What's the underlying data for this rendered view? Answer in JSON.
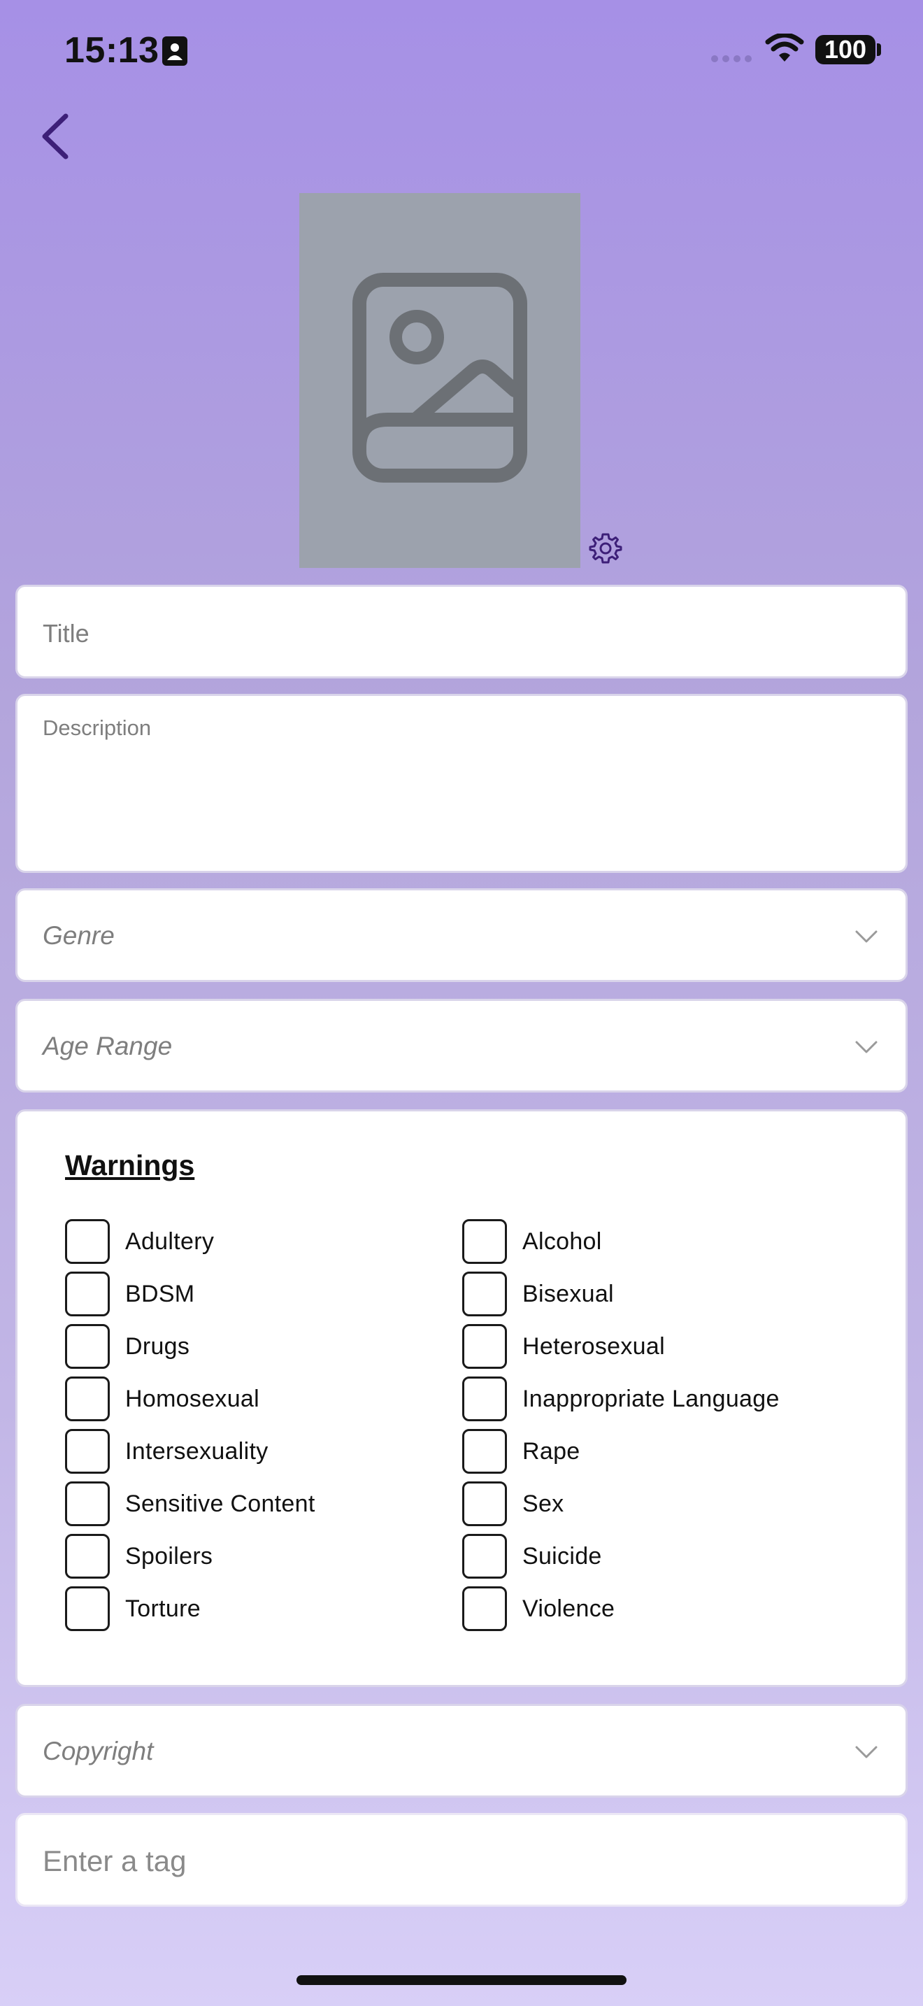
{
  "status_bar": {
    "time": "15:13",
    "battery": "100"
  },
  "form": {
    "title_placeholder": "Title",
    "description_placeholder": "Description",
    "genre_label": "Genre",
    "age_range_label": "Age Range",
    "copyright_label": "Copyright",
    "tag_placeholder": "Enter a tag"
  },
  "warnings": {
    "heading": "Warnings",
    "left_column": [
      "Adultery",
      "BDSM",
      "Drugs",
      "Homosexual",
      "Intersexuality",
      "Sensitive Content",
      "Spoilers",
      "Torture"
    ],
    "right_column": [
      "Alcohol",
      "Bisexual",
      "Heterosexual",
      "Inappropriate Language",
      "Rape",
      "Sex",
      "Suicide",
      "Violence"
    ]
  },
  "icons": {
    "back": "chevron-left-icon",
    "cover": "image-placeholder-icon",
    "settings": "gear-icon",
    "dropdown": "chevron-down-icon"
  },
  "colors": {
    "accent": "#3d1f78",
    "background_top": "#a690e6",
    "background_bottom": "#d8cff7",
    "cover_placeholder": "#9ca2ad"
  }
}
